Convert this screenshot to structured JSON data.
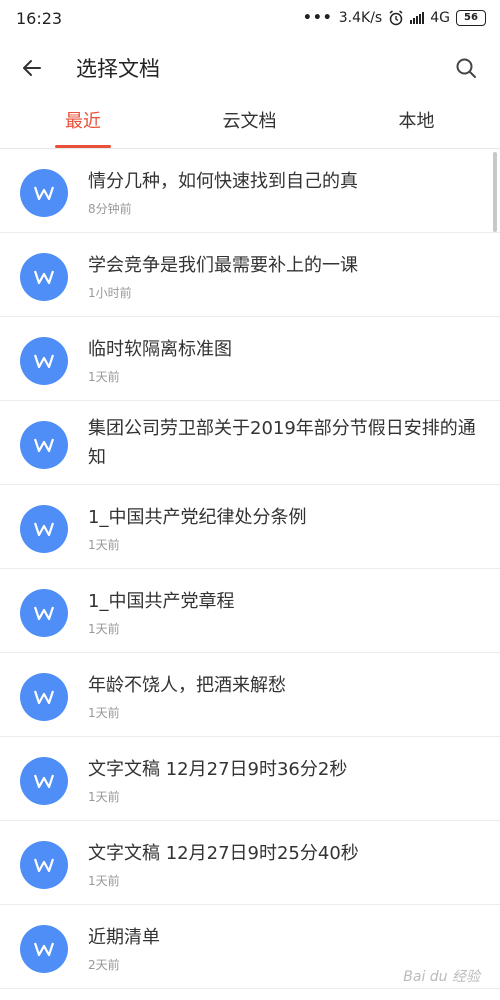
{
  "status_bar": {
    "time": "16:23",
    "net_speed": "3.4K/s",
    "network": "4G",
    "battery": "56"
  },
  "header": {
    "title": "选择文档",
    "back_icon": "arrow-left-icon",
    "search_icon": "search-icon"
  },
  "tabs": [
    {
      "label": "最近"
    },
    {
      "label": "云文档"
    },
    {
      "label": "本地"
    }
  ],
  "files": [
    {
      "name": "情分几种，如何快速找到自己的真",
      "time": "8分钟前"
    },
    {
      "name": "学会竞争是我们最需要补上的一课",
      "time": "1小时前"
    },
    {
      "name": "临时软隔离标准图",
      "time": "1天前"
    },
    {
      "name": "集团公司劳卫部关于2019年部分节假日安排的通知",
      "time": ""
    },
    {
      "name": "1_中国共产党纪律处分条例",
      "time": "1天前"
    },
    {
      "name": "1_中国共产党章程",
      "time": "1天前"
    },
    {
      "name": "年龄不饶人，把酒来解愁",
      "time": "1天前"
    },
    {
      "name": "文字文稿 12月27日9时36分2秒",
      "time": "1天前"
    },
    {
      "name": "文字文稿 12月27日9时25分40秒",
      "time": "1天前"
    },
    {
      "name": "近期清单",
      "time": "2天前"
    }
  ],
  "colors": {
    "accent": "#e8503a",
    "doc_icon": "#4f8ef7"
  },
  "watermark": "Bai du 经验"
}
